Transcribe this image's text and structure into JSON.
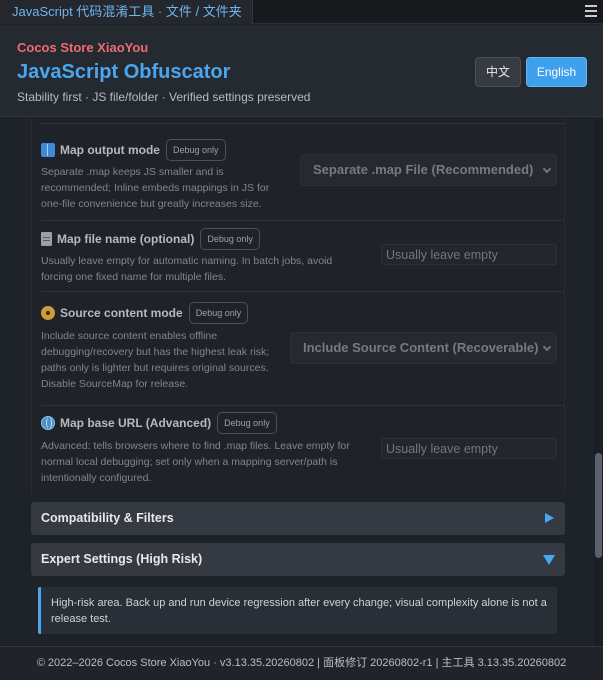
{
  "window": {
    "title": "JavaScript 代码混淆工具 · 文件 / 文件夹",
    "menu_icon": "hamburger-menu-icon"
  },
  "header": {
    "brand": "Cocos Store XiaoYou",
    "title": "JavaScript Obfuscator",
    "subtitle": "Stability first · JS file/folder · Verified settings preserved",
    "lang_zh": "中文",
    "lang_en": "English",
    "active_language": "English"
  },
  "settings": [
    {
      "icon": "book-icon",
      "title": "Map output mode",
      "badge": "Debug only",
      "description": "Separate .map keeps JS smaller and is recommended; Inline embeds mappings in JS for one-file convenience but greatly increases size.",
      "control": "select",
      "value": "Separate .map File (Recommended)"
    },
    {
      "icon": "document-icon",
      "title": "Map file name (optional)",
      "badge": "Debug only",
      "description": "Usually leave empty for automatic naming. In batch jobs, avoid forcing one fixed name for multiple files.",
      "control": "input",
      "placeholder": "Usually leave empty"
    },
    {
      "icon": "disc-icon",
      "title": "Source content mode",
      "badge": "Debug only",
      "description": "Include source content enables offline debugging/recovery but has the highest leak risk; paths only is lighter but requires original sources. Disable SourceMap for release.",
      "control": "select",
      "value": "Include Source Content (Recoverable)"
    },
    {
      "icon": "globe-icon",
      "title": "Map base URL (Advanced)",
      "badge": "Debug only",
      "description": "Advanced: tells browsers where to find .map files. Leave empty for normal local debugging; set only when a mapping server/path is intentionally configured.",
      "control": "input",
      "placeholder": "Usually leave empty"
    }
  ],
  "sections": [
    {
      "label": "Compatibility & Filters",
      "state": "collapsed"
    },
    {
      "label": "Expert Settings (High Risk)",
      "state": "expanded"
    }
  ],
  "warning": "High-risk area. Back up and run device regression after every change; visual complexity alone is not a release test.",
  "footer": "© 2022–2026 Cocos Store XiaoYou · v3.13.35.20260802 | 面板修订 20260802-r1 | 主工具 3.13.35.20260802",
  "colors": {
    "accent": "#4aa6ee",
    "brand": "#f06a73",
    "background": "#1e2229"
  }
}
